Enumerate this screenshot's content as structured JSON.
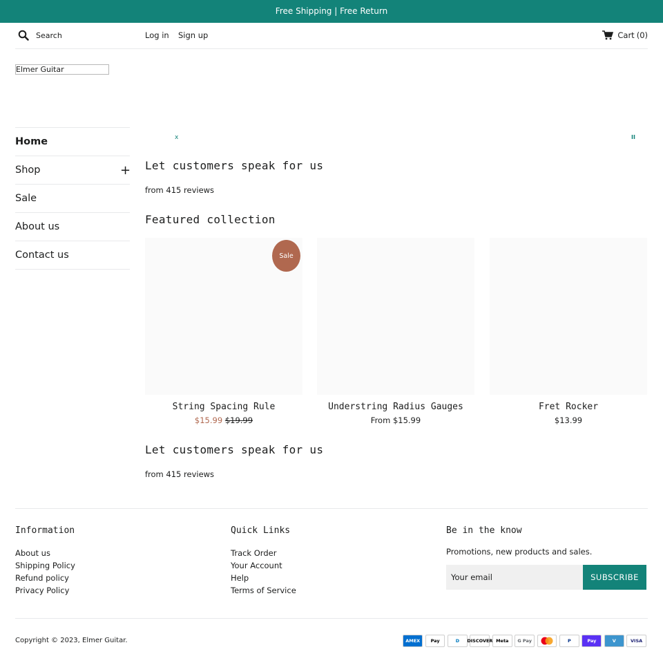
{
  "announcement": "Free Shipping | Free Return",
  "header": {
    "search_placeholder": "Search",
    "login": "Log in",
    "signup": "Sign up",
    "cart_label": "Cart",
    "cart_count": "(0)"
  },
  "logo": "Elmer Guitar",
  "sidebar": {
    "items": [
      {
        "label": "Home"
      },
      {
        "label": "Shop",
        "expand": "+"
      },
      {
        "label": "Sale"
      },
      {
        "label": "About us"
      },
      {
        "label": "Contact us"
      }
    ]
  },
  "slideshow": {
    "close_symbol": "x",
    "pause_symbol": "II"
  },
  "reviews_section_1": {
    "title": "Let customers speak for us",
    "summary": "from 415 reviews"
  },
  "featured": {
    "title": "Featured collection",
    "products": [
      {
        "name": "String Spacing Rule",
        "badge": "Sale",
        "price": "$15.99",
        "compare_price": "$19.99"
      },
      {
        "name": "Understring Radius Gauges",
        "price": "From $15.99"
      },
      {
        "name": "Fret Rocker",
        "price": "$13.99"
      }
    ]
  },
  "reviews_section_2": {
    "title": "Let customers speak for us",
    "summary": "from 415 reviews"
  },
  "footer": {
    "information": {
      "title": "Information",
      "links": [
        "About us",
        "Shipping Policy",
        "Refund policy",
        "Privacy Policy"
      ]
    },
    "quick_links": {
      "title": "Quick Links",
      "links": [
        "Track Order",
        "Your Account",
        "Help",
        "Terms of Service"
      ]
    },
    "newsletter": {
      "title": "Be in the know",
      "text": "Promotions, new products and sales.",
      "email_placeholder": "Your email",
      "button": "SUBSCRIBE"
    },
    "copyright": "Copyright © 2023, Elmer Guitar.",
    "payments": [
      {
        "label": "AMEX",
        "icon": "amex-icon",
        "color": "#016fd0",
        "text": "#ffffff"
      },
      {
        "label": "Pay",
        "icon": "apple-pay-icon",
        "color": "#ffffff",
        "text": "#000000"
      },
      {
        "label": "D",
        "icon": "diners-club-icon",
        "color": "#ffffff",
        "text": "#0079be"
      },
      {
        "label": "DISCOVER",
        "icon": "discover-icon",
        "color": "#ffffff",
        "text": "#000000"
      },
      {
        "label": "Meta",
        "icon": "meta-pay-icon",
        "color": "#ffffff",
        "text": "#000000"
      },
      {
        "label": "G Pay",
        "icon": "google-pay-icon",
        "color": "#ffffff",
        "text": "#5f6368"
      },
      {
        "label": "",
        "icon": "mastercard-icon",
        "color": "#ffffff",
        "text": "#000000"
      },
      {
        "label": "P",
        "icon": "paypal-icon",
        "color": "#ffffff",
        "text": "#003087"
      },
      {
        "label": "Pay",
        "icon": "shop-pay-icon",
        "color": "#5a31f4",
        "text": "#ffffff"
      },
      {
        "label": "V",
        "icon": "venmo-icon",
        "color": "#3d95ce",
        "text": "#ffffff"
      },
      {
        "label": "VISA",
        "icon": "visa-icon",
        "color": "#ffffff",
        "text": "#1a1f71"
      }
    ]
  }
}
